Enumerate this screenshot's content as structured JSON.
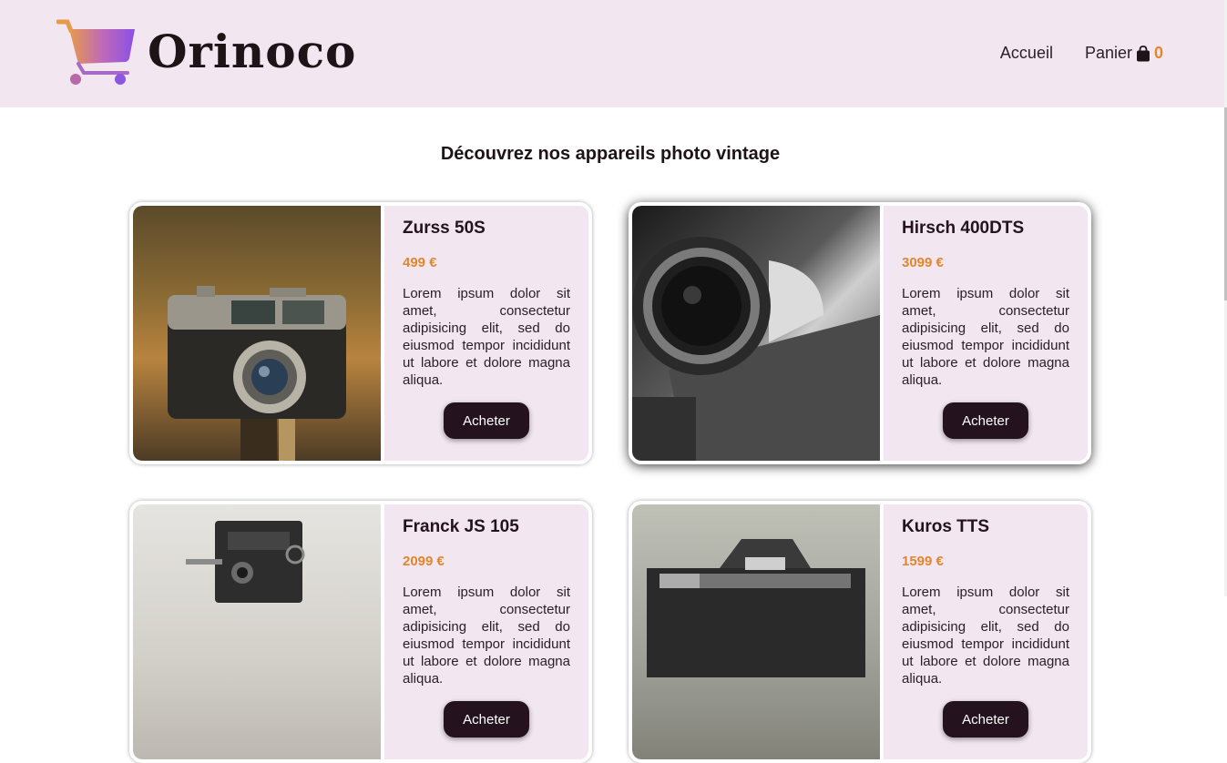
{
  "header": {
    "logo_text": "Orinoco",
    "nav": {
      "home_label": "Accueil",
      "cart_label": "Panier",
      "cart_count": "0"
    }
  },
  "main": {
    "title": "Découvrez nos appareils photo vintage",
    "products": [
      {
        "name": "Zurss 50S",
        "price": "499 €",
        "description": "Lorem ipsum dolor sit amet, consectetur adipisicing elit, sed do eiusmod tempor incididunt ut labore et dolore magna aliqua.",
        "button_label": "Acheter"
      },
      {
        "name": "Hirsch 400DTS",
        "price": "3099 €",
        "description": "Lorem ipsum dolor sit amet, consectetur adipisicing elit, sed do eiusmod tempor incididunt ut labore et dolore magna aliqua.",
        "button_label": "Acheter"
      },
      {
        "name": "Franck JS 105",
        "price": "2099 €",
        "description": "Lorem ipsum dolor sit amet, consectetur adipisicing elit, sed do eiusmod tempor incididunt ut labore et dolore magna aliqua.",
        "button_label": "Acheter"
      },
      {
        "name": "Kuros TTS",
        "price": "1599 €",
        "description": "Lorem ipsum dolor sit amet, consectetur adipisicing elit, sed do eiusmod tempor incididunt ut labore et dolore magna aliqua.",
        "button_label": "Acheter"
      }
    ]
  },
  "colors": {
    "header_bg": "#f2e7f0",
    "accent_orange": "#e0862d",
    "dark_button": "#24131f"
  },
  "icons": {
    "logo": "shopping-cart-icon",
    "cart": "shopping-bag-icon"
  }
}
